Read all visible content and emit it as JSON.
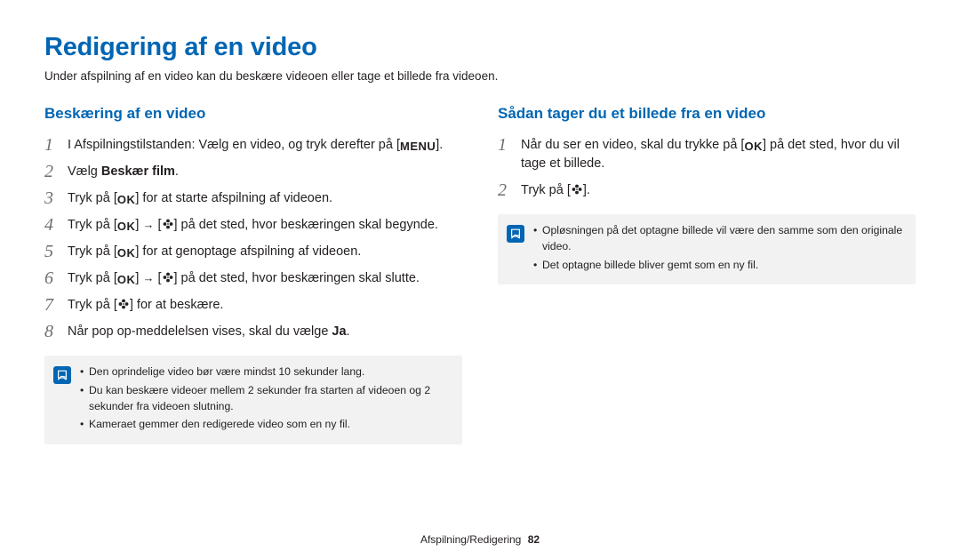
{
  "title": "Redigering af en video",
  "intro": "Under afspilning af en video kan du beskære videoen eller tage et billede fra videoen.",
  "left": {
    "heading": "Beskæring af en video",
    "step1_a": "I Afspilningstilstanden: Vælg en video, og tryk derefter på [",
    "step1_b": "].",
    "step2_a": "Vælg ",
    "step2_b": "Beskær film",
    "step2_c": ".",
    "step3_a": "Tryk på [",
    "step3_b": "] for at starte afspilning af videoen.",
    "step4_a": "Tryk på [",
    "step4_b": "] ",
    "step4_c": " [",
    "step4_d": "] på det sted, hvor beskæringen skal begynde.",
    "step5_a": "Tryk på [",
    "step5_b": "] for at genoptage afspilning af videoen.",
    "step6_a": "Tryk på [",
    "step6_b": "] ",
    "step6_c": " [",
    "step6_d": "] på det sted, hvor beskæringen skal slutte.",
    "step7_a": "Tryk på [",
    "step7_b": "] for at beskære.",
    "step8_a": "Når pop op-meddelelsen vises, skal du vælge ",
    "step8_b": "Ja",
    "step8_c": ".",
    "notes": [
      "Den oprindelige video bør være mindst 10 sekunder lang.",
      "Du kan beskære videoer mellem 2 sekunder fra starten af videoen og 2 sekunder fra videoen slutning.",
      "Kameraet gemmer den redigerede video som en ny fil."
    ]
  },
  "right": {
    "heading": "Sådan tager du et billede fra en video",
    "step1_a": "Når du ser en video, skal du trykke på [",
    "step1_b": "] på det sted, hvor du vil tage et billede.",
    "step2_a": "Tryk på [",
    "step2_b": "].",
    "notes": [
      "Opløsningen på det optagne billede vil være den samme som den originale video.",
      "Det optagne billede bliver gemt som en ny fil."
    ]
  },
  "footer": {
    "section": "Afspilning/Redigering",
    "page": "82"
  },
  "icons": {
    "menu": "MENU",
    "ok": "OK",
    "arrow": "→"
  }
}
